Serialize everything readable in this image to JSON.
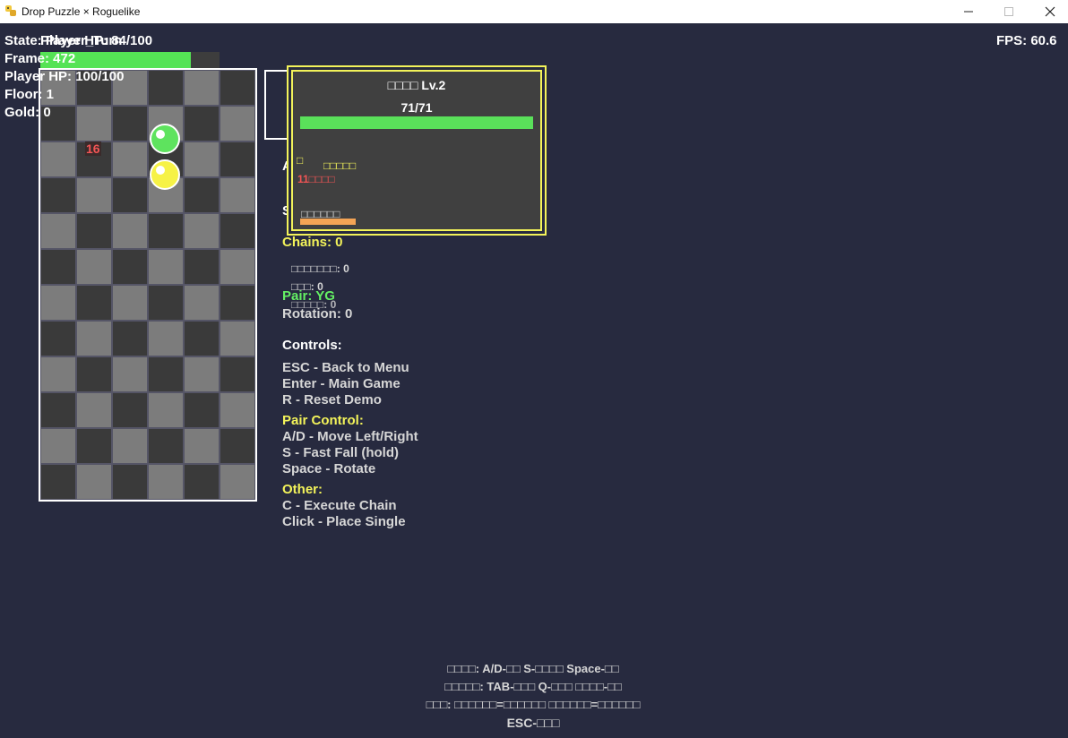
{
  "window": {
    "title": "Drop Puzzle × Roguelike",
    "icons": [
      "python-icon",
      "minimize-icon",
      "maximize-icon",
      "close-icon"
    ]
  },
  "hud": {
    "state_text": "State: Player_Turn",
    "player_hp_bar_label": "Player HP: 84/100",
    "player_hp_fraction": 0.84,
    "frame_text": "Frame: 472",
    "player_hp_text": "Player HP: 100/100",
    "floor_text": "Floor: 1",
    "gold_text": "Gold: 0",
    "fps_text": "FPS: 60.6"
  },
  "board": {
    "cols": 6,
    "rows": 12,
    "damage_number": "16",
    "orbs": [
      {
        "name": "green-orb",
        "color": "#5ee35e"
      },
      {
        "name": "yellow-orb",
        "color": "#f6f246"
      }
    ]
  },
  "enemy": {
    "name_level": "□□□□ Lv.2",
    "hp_text": "71/71",
    "hp_fraction": 1.0,
    "status_icon": "□",
    "intent_label": "□□□□□",
    "attack_text": "11□□□□",
    "action_label": "□□□□□□",
    "action_fraction": 0.24
  },
  "stats": {
    "hidden_a": "A",
    "hidden_s": "S",
    "chains": "Chains: 0",
    "stat_a": "□□□□□□□: 0",
    "stat_b": "□□□: 0",
    "stat_c": "□□□□□: 0",
    "pair": "Pair: YG",
    "rotation": "Rotation: 0"
  },
  "controls": {
    "heading": "Controls:",
    "items": [
      "ESC - Back to Menu",
      "Enter - Main Game",
      "R - Reset Demo"
    ],
    "pair_heading": "Pair Control:",
    "pair_items": [
      "A/D - Move Left/Right",
      "S - Fast Fall (hold)",
      "Space - Rotate"
    ],
    "other_heading": "Other:",
    "other_items": [
      "C - Execute Chain",
      "Click - Place Single"
    ]
  },
  "footer": {
    "lines": [
      "□□□□: A/D-□□ S-□□□□ Space-□□",
      "□□□□□: TAB-□□□ Q-□□□ □□□□-□□",
      "□□□: □□□□□□=□□□□□□ □□□□□□=□□□□□□",
      "ESC-□□□"
    ]
  },
  "colors": {
    "background": "#272a3f",
    "accent_yellow": "#f3f35a",
    "accent_green": "#64f064",
    "damage_red": "#f25555"
  }
}
